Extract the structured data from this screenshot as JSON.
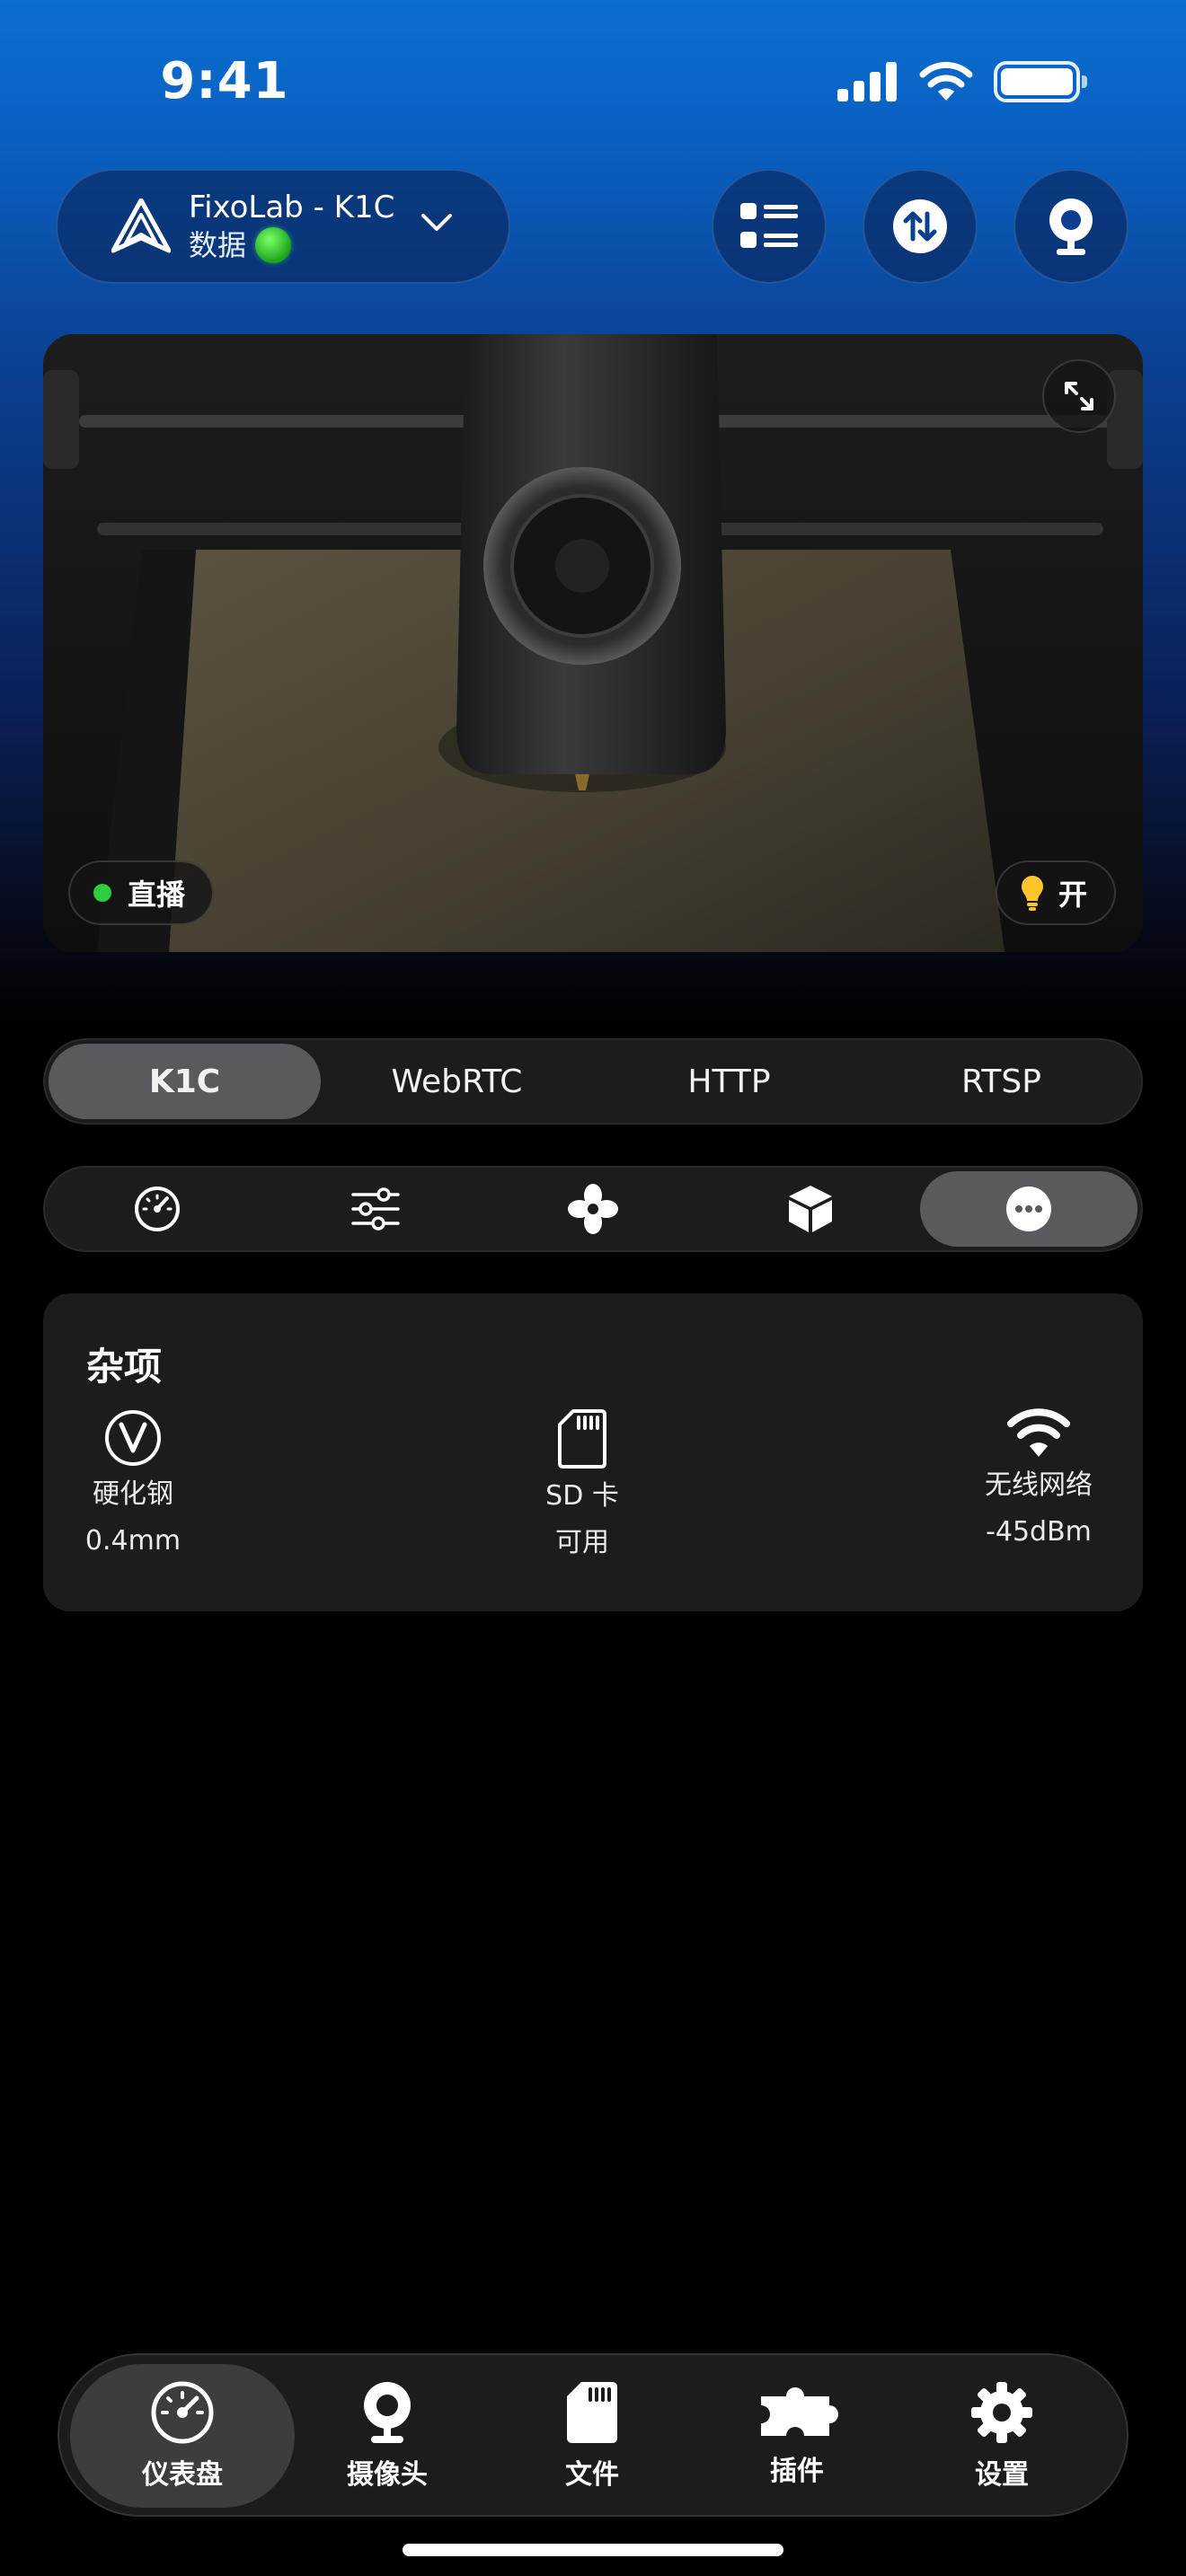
{
  "status_bar": {
    "time": "9:41"
  },
  "printer": {
    "name": "FixoLab - K1C",
    "subtitle": "数据"
  },
  "camera": {
    "live_label": "直播",
    "light_label": "开"
  },
  "stream_modes": [
    {
      "label": "K1C",
      "active": true
    },
    {
      "label": "WebRTC",
      "active": false
    },
    {
      "label": "HTTP",
      "active": false
    },
    {
      "label": "RTSP",
      "active": false
    }
  ],
  "control_tabs": [
    {
      "icon": "gauge-icon",
      "active": false
    },
    {
      "icon": "sliders-icon",
      "active": false
    },
    {
      "icon": "fan-icon",
      "active": false
    },
    {
      "icon": "box-icon",
      "active": false
    },
    {
      "icon": "more-icon",
      "active": true
    }
  ],
  "misc": {
    "title": "杂项",
    "nozzle": {
      "label": "硬化钢",
      "value": "0.4mm"
    },
    "sd": {
      "label": "SD 卡",
      "value": "可用"
    },
    "wifi": {
      "label": "无线网络",
      "value": "-45dBm"
    }
  },
  "bottom_nav": [
    {
      "label": "仪表盘",
      "icon": "dashboard-icon",
      "active": true
    },
    {
      "label": "摄像头",
      "icon": "webcam-icon",
      "active": false
    },
    {
      "label": "文件",
      "icon": "file-icon",
      "active": false
    },
    {
      "label": "插件",
      "icon": "puzzle-icon",
      "active": false
    },
    {
      "label": "设置",
      "icon": "gear-icon",
      "active": false
    }
  ],
  "colors": {
    "accent_blue": "#0a6fd1",
    "online_green": "#2ecc40",
    "card_bg": "#1c1c1e"
  }
}
